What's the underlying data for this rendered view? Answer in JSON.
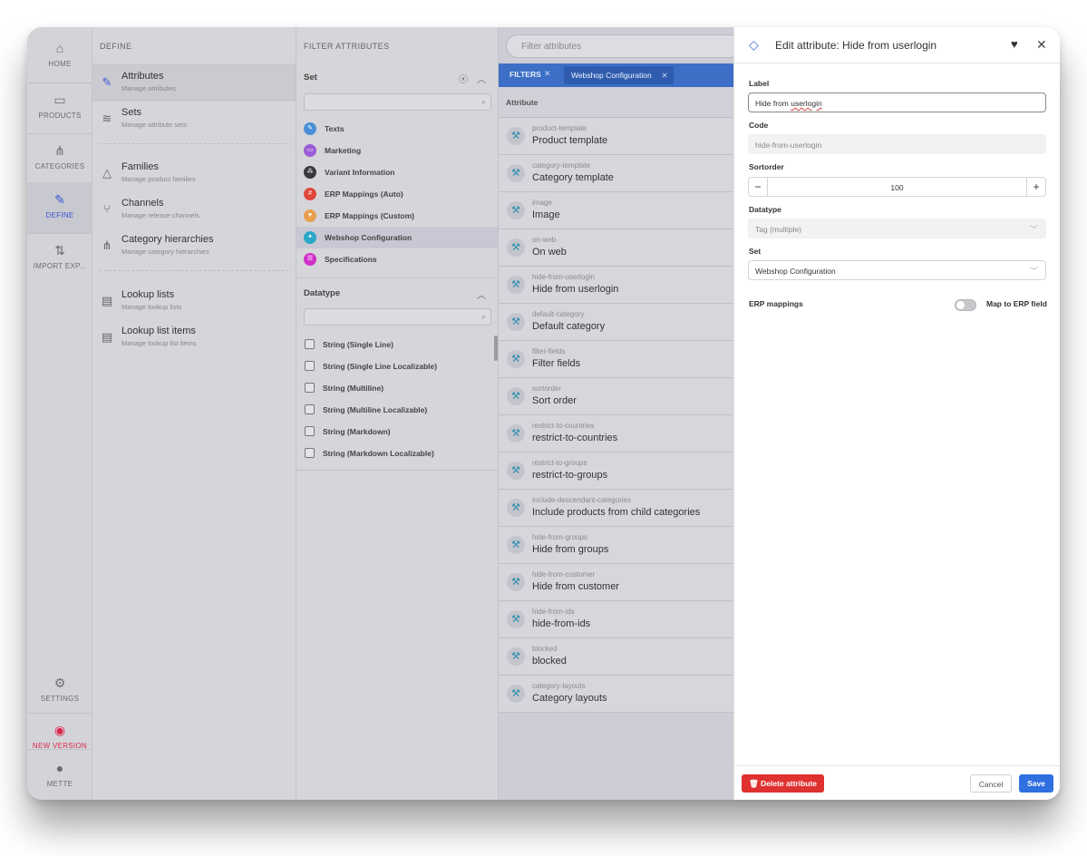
{
  "rail": {
    "items": [
      {
        "label": "HOME",
        "icon": "⌂"
      },
      {
        "label": "PRODUCTS",
        "icon": "▭"
      },
      {
        "label": "CATEGORIES",
        "icon": "⋔"
      },
      {
        "label": "DEFINE",
        "icon": "✎"
      },
      {
        "label": "IMPORT EXP...",
        "icon": "⇅"
      }
    ],
    "settings": {
      "label": "SETTINGS",
      "icon": "⚙"
    },
    "new_version": {
      "label": "NEW VERSION",
      "icon": "◉"
    },
    "user": {
      "label": "METTE",
      "icon": "●"
    }
  },
  "define": {
    "title": "DEFINE",
    "items": [
      {
        "title": "Attributes",
        "subtitle": "Manage attributes",
        "icon": "✎"
      },
      {
        "title": "Sets",
        "subtitle": "Manage attribute sets",
        "icon": "≋"
      },
      {
        "title": "Families",
        "subtitle": "Manage product families",
        "icon": "△"
      },
      {
        "title": "Channels",
        "subtitle": "Manage release channels",
        "icon": "⑂"
      },
      {
        "title": "Category hierarchies",
        "subtitle": "Manage category hierarchies",
        "icon": "⋔"
      },
      {
        "title": "Lookup lists",
        "subtitle": "Manage lookup lists",
        "icon": "▤"
      },
      {
        "title": "Lookup list items",
        "subtitle": "Manage lookup list items",
        "icon": "▤"
      }
    ]
  },
  "filter": {
    "title": "FILTER ATTRIBUTES",
    "set_header": "Set",
    "sets": [
      {
        "label": "Texts",
        "color": "#4a8fd8",
        "icon": "✎"
      },
      {
        "label": "Marketing",
        "color": "#9c5cd6",
        "icon": "▭"
      },
      {
        "label": "Variant Information",
        "color": "#3a3a3e",
        "icon": "⁂"
      },
      {
        "label": "ERP Mappings (Auto)",
        "color": "#e0483a",
        "icon": "#"
      },
      {
        "label": "ERP Mappings (Custom)",
        "color": "#e8a050",
        "icon": "♥"
      },
      {
        "label": "Webshop Configuration",
        "color": "#2aa8c8",
        "icon": "✦"
      },
      {
        "label": "Specifications",
        "color": "#d030c8",
        "icon": "☰"
      }
    ],
    "datatype_header": "Datatype",
    "datatypes": [
      "String (Single Line)",
      "String (Single Line Localizable)",
      "String (Multiline)",
      "String (Multiline Localizable)",
      "String (Markdown)",
      "String (Markdown Localizable)"
    ]
  },
  "list": {
    "search_placeholder": "Filter attributes",
    "filters_label": "FILTERS",
    "active_filter": "Webshop Configuration",
    "column_header": "Attribute",
    "rows": [
      {
        "code": "product-template",
        "name": "Product template"
      },
      {
        "code": "category-template",
        "name": "Category template"
      },
      {
        "code": "image",
        "name": "Image"
      },
      {
        "code": "on-web",
        "name": "On web"
      },
      {
        "code": "hide-from-userlogin",
        "name": "Hide from userlogin"
      },
      {
        "code": "default-category",
        "name": "Default category"
      },
      {
        "code": "filter-fields",
        "name": "Filter fields"
      },
      {
        "code": "sortorder",
        "name": "Sort order"
      },
      {
        "code": "restrict-to-countries",
        "name": "restrict-to-countries"
      },
      {
        "code": "restrict-to-groups",
        "name": "restrict-to-groups"
      },
      {
        "code": "include-descendant-categories",
        "name": "Include products from child categories"
      },
      {
        "code": "hide-from-groups",
        "name": "Hide from groups"
      },
      {
        "code": "hide-from-customer",
        "name": "Hide from customer"
      },
      {
        "code": "hide-from-ids",
        "name": "hide-from-ids"
      },
      {
        "code": "blocked",
        "name": "blocked"
      },
      {
        "code": "category-layouts",
        "name": "Category layouts"
      }
    ]
  },
  "panel": {
    "title": "Edit attribute: Hide from userlogin",
    "label_label": "Label",
    "label_value_prefix": "Hide from ",
    "label_value_word": "userlogin",
    "code_label": "Code",
    "code_value": "hide-from-userlogin",
    "sortorder_label": "Sortorder",
    "sortorder_value": "100",
    "datatype_label": "Datatype",
    "datatype_value": "Tag (multiple)",
    "set_label": "Set",
    "set_value": "Webshop Configuration",
    "erp_label": "ERP mappings",
    "erp_toggle_label": "Map to ERP field",
    "delete_label": "Delete attribute",
    "cancel_label": "Cancel",
    "save_label": "Save"
  }
}
